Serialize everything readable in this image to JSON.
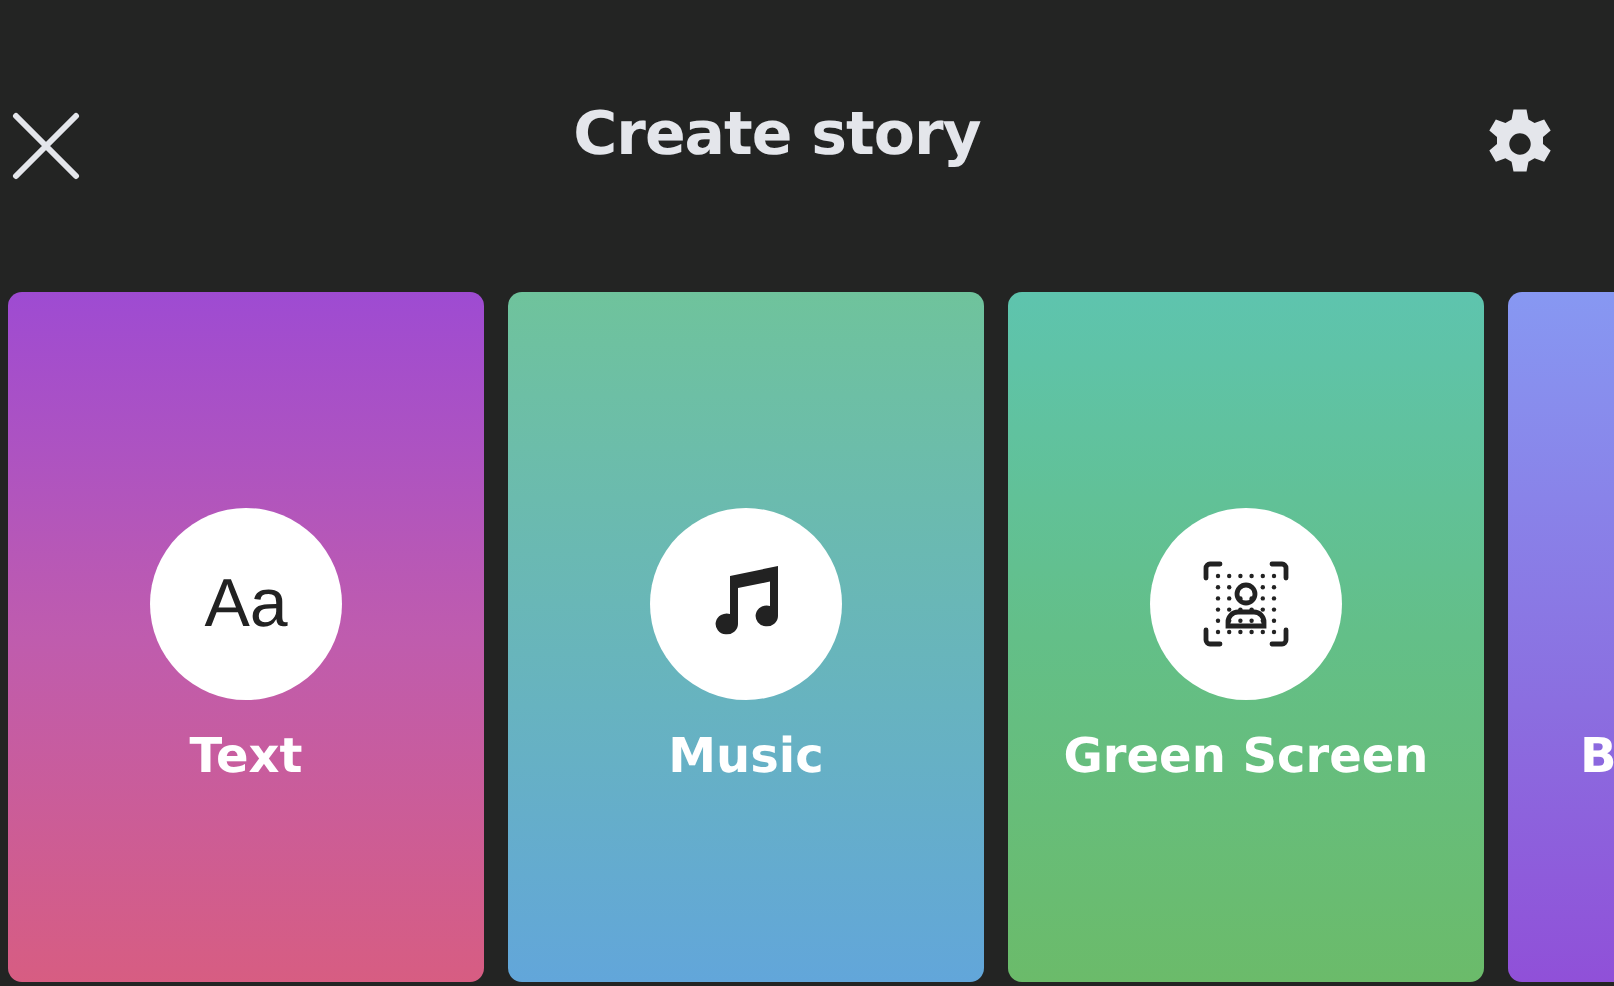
{
  "header": {
    "title": "Create story"
  },
  "cards": [
    {
      "kind": "text",
      "icon_text": "Aa",
      "label": "Text"
    },
    {
      "kind": "music",
      "label": "Music"
    },
    {
      "kind": "green_screen",
      "label": "Green Screen"
    },
    {
      "kind": "partial",
      "label": "B"
    }
  ]
}
